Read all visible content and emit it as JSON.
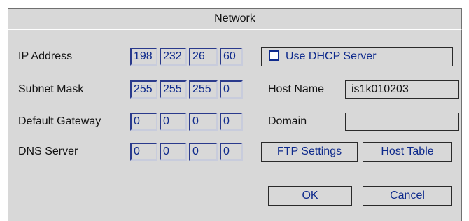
{
  "window": {
    "title": "Network"
  },
  "ip_address": {
    "label": "IP Address",
    "octets": [
      "198",
      "232",
      "26",
      "60"
    ]
  },
  "subnet_mask": {
    "label": "Subnet Mask",
    "octets": [
      "255",
      "255",
      "255",
      "0"
    ]
  },
  "default_gateway": {
    "label": "Default Gateway",
    "octets": [
      "0",
      "0",
      "0",
      "0"
    ]
  },
  "dns_server": {
    "label": "DNS Server",
    "octets": [
      "0",
      "0",
      "0",
      "0"
    ]
  },
  "dhcp": {
    "label": "Use DHCP Server",
    "checked": false
  },
  "host_name": {
    "label": "Host Name",
    "value": "is1k010203"
  },
  "domain": {
    "label": "Domain",
    "value": ""
  },
  "buttons": {
    "ftp_settings": "FTP Settings",
    "host_table": "Host Table",
    "ok": "OK",
    "cancel": "Cancel"
  }
}
